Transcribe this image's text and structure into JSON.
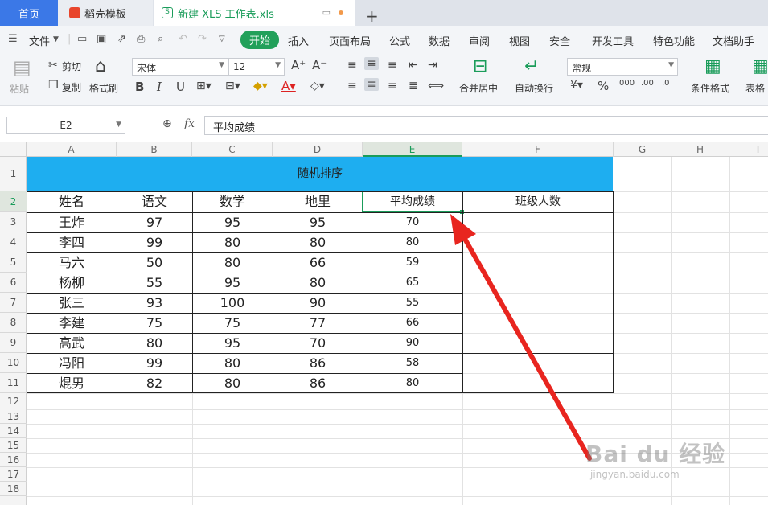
{
  "tabs": {
    "home": "首页",
    "templates": "稻壳模板",
    "file": "新建 XLS 工作表.xls",
    "add": "+"
  },
  "menubar": {
    "file_menu": "文件",
    "items": [
      "开始",
      "插入",
      "页面布局",
      "公式",
      "数据",
      "审阅",
      "视图",
      "安全",
      "开发工具",
      "特色功能",
      "文档助手"
    ]
  },
  "ribbon": {
    "paste": "粘贴",
    "cut": "剪切",
    "copy": "复制",
    "format_painter": "格式刷",
    "font_name": "宋体",
    "font_size": "12",
    "merge_center": "合并居中",
    "wrap_text": "自动换行",
    "number_format": "常规",
    "conditional_format": "条件格式",
    "table_style": "表格"
  },
  "formula_bar": {
    "cell_ref": "E2",
    "fx": "fx",
    "content": "平均成绩"
  },
  "columns": [
    "A",
    "B",
    "C",
    "D",
    "E",
    "F",
    "G",
    "H",
    "I"
  ],
  "rows": [
    "1",
    "2",
    "3",
    "4",
    "5",
    "6",
    "7",
    "8",
    "9",
    "10",
    "11",
    "12",
    "13",
    "14",
    "15",
    "16",
    "17",
    "18"
  ],
  "sheet": {
    "title": "随机排序",
    "headers": [
      "姓名",
      "语文",
      "数学",
      "地里",
      "平均成绩",
      "班级人数"
    ],
    "data": [
      [
        "王炸",
        "97",
        "95",
        "95",
        "70"
      ],
      [
        "李四",
        "99",
        "80",
        "80",
        "80"
      ],
      [
        "马六",
        "50",
        "80",
        "66",
        "59"
      ],
      [
        "杨柳",
        "55",
        "95",
        "80",
        "65"
      ],
      [
        "张三",
        "93",
        "100",
        "90",
        "55"
      ],
      [
        "李建",
        "75",
        "75",
        "77",
        "66"
      ],
      [
        "高武",
        "80",
        "95",
        "70",
        "90"
      ],
      [
        "冯阳",
        "99",
        "80",
        "86",
        "58"
      ],
      [
        "焜男",
        "82",
        "80",
        "86",
        "80"
      ]
    ]
  },
  "watermark": {
    "brand": "Bai  du 经验",
    "url": "jingyan.baidu.com"
  },
  "colors": {
    "title_fill": "#1eaef0",
    "accent_green": "#1a9c5a",
    "annotation_arrow": "#e8251f"
  }
}
